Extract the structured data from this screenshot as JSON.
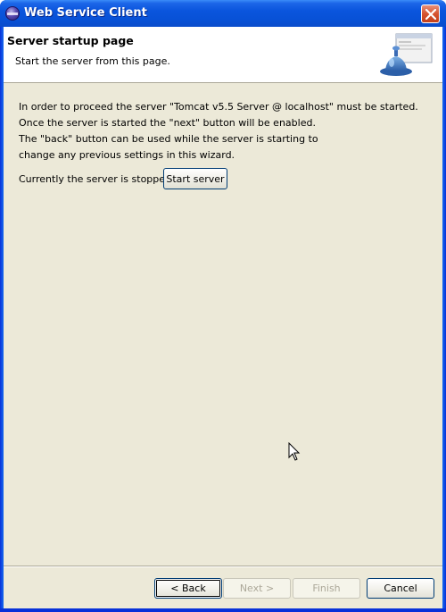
{
  "window": {
    "title": "Web Service Client",
    "icon": "eclipse-icon",
    "close_icon": "close-icon"
  },
  "banner": {
    "title": "Server startup page",
    "subtitle": "Start the server from this page.",
    "graphic": "server-bell-icon"
  },
  "content": {
    "info_lines": [
      "In order to proceed the server \"Tomcat v5.5 Server @ localhost\" must be started.",
      "Once the server is started the \"next\" button will be enabled.",
      "The \"back\" button can be used while the server is starting to",
      "change any previous settings in this wizard."
    ],
    "status": "Currently the server is stopped.",
    "start_button": "Start server"
  },
  "footer": {
    "back": "< Back",
    "next": "Next >",
    "finish": "Finish",
    "cancel": "Cancel"
  },
  "colors": {
    "title_bar": "#0a55dd",
    "dialog_bg": "#ece9d8",
    "banner_bg": "#ffffff",
    "disabled_text": "#aca899",
    "close_button": "#d5532f"
  }
}
